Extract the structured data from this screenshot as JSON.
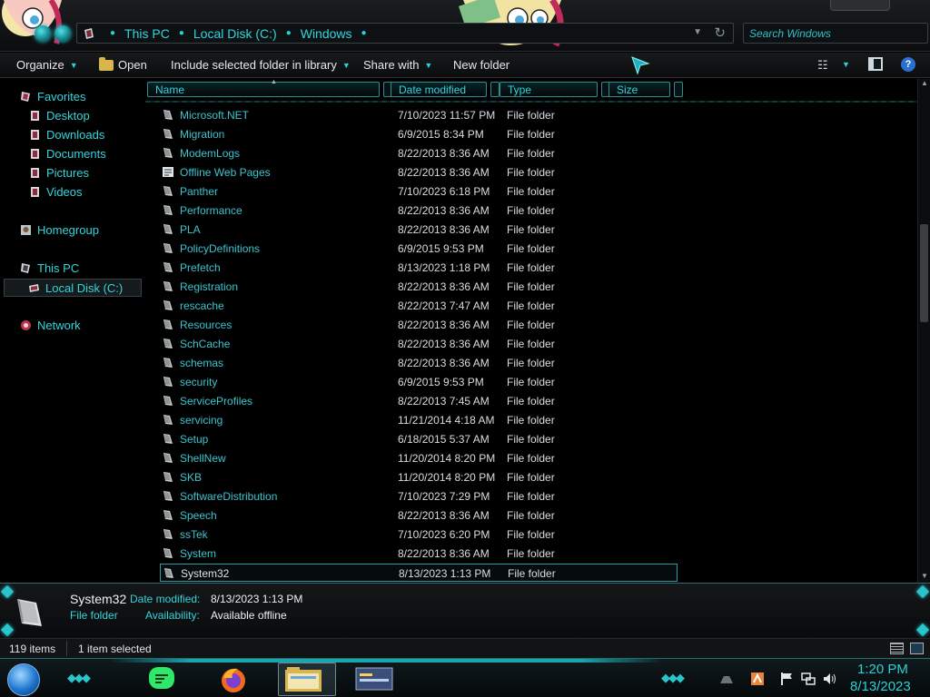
{
  "address": {
    "crumbs": [
      "This PC",
      "Local Disk (C:)",
      "Windows"
    ]
  },
  "search": {
    "placeholder": "Search Windows"
  },
  "toolbar": {
    "organize": "Organize",
    "open": "Open",
    "include": "Include selected folder in library",
    "share": "Share with",
    "new_folder": "New folder"
  },
  "nav": {
    "favorites": "Favorites",
    "desktop": "Desktop",
    "downloads": "Downloads",
    "documents": "Documents",
    "pictures": "Pictures",
    "videos": "Videos",
    "homegroup": "Homegroup",
    "this_pc": "This PC",
    "local_disk": "Local Disk (C:)",
    "network": "Network"
  },
  "columns": {
    "name": "Name",
    "date": "Date modified",
    "type": "Type",
    "size": "Size"
  },
  "files": [
    {
      "name": "Microsoft.NET",
      "date": "7/10/2023 11:57 PM",
      "type": "File folder"
    },
    {
      "name": "Migration",
      "date": "6/9/2015 8:34 PM",
      "type": "File folder"
    },
    {
      "name": "ModemLogs",
      "date": "8/22/2013 8:36 AM",
      "type": "File folder"
    },
    {
      "name": "Offline Web Pages",
      "date": "8/22/2013 8:36 AM",
      "type": "File folder"
    },
    {
      "name": "Panther",
      "date": "7/10/2023 6:18 PM",
      "type": "File folder"
    },
    {
      "name": "Performance",
      "date": "8/22/2013 8:36 AM",
      "type": "File folder"
    },
    {
      "name": "PLA",
      "date": "8/22/2013 8:36 AM",
      "type": "File folder"
    },
    {
      "name": "PolicyDefinitions",
      "date": "6/9/2015 9:53 PM",
      "type": "File folder"
    },
    {
      "name": "Prefetch",
      "date": "8/13/2023 1:18 PM",
      "type": "File folder"
    },
    {
      "name": "Registration",
      "date": "8/22/2013 8:36 AM",
      "type": "File folder"
    },
    {
      "name": "rescache",
      "date": "8/22/2013 7:47 AM",
      "type": "File folder"
    },
    {
      "name": "Resources",
      "date": "8/22/2013 8:36 AM",
      "type": "File folder"
    },
    {
      "name": "SchCache",
      "date": "8/22/2013 8:36 AM",
      "type": "File folder"
    },
    {
      "name": "schemas",
      "date": "8/22/2013 8:36 AM",
      "type": "File folder"
    },
    {
      "name": "security",
      "date": "6/9/2015 9:53 PM",
      "type": "File folder"
    },
    {
      "name": "ServiceProfiles",
      "date": "8/22/2013 7:45 AM",
      "type": "File folder"
    },
    {
      "name": "servicing",
      "date": "11/21/2014 4:18 AM",
      "type": "File folder"
    },
    {
      "name": "Setup",
      "date": "6/18/2015 5:37 AM",
      "type": "File folder"
    },
    {
      "name": "ShellNew",
      "date": "11/20/2014 8:20 PM",
      "type": "File folder"
    },
    {
      "name": "SKB",
      "date": "11/20/2014 8:20 PM",
      "type": "File folder"
    },
    {
      "name": "SoftwareDistribution",
      "date": "7/10/2023 7:29 PM",
      "type": "File folder"
    },
    {
      "name": "Speech",
      "date": "8/22/2013 8:36 AM",
      "type": "File folder"
    },
    {
      "name": "ssTek",
      "date": "7/10/2023 6:20 PM",
      "type": "File folder"
    },
    {
      "name": "System",
      "date": "8/22/2013 8:36 AM",
      "type": "File folder"
    },
    {
      "name": "System32",
      "date": "8/13/2023 1:13 PM",
      "type": "File folder"
    }
  ],
  "selected_index": 24,
  "details": {
    "name": "System32",
    "type": "File folder",
    "modified_label": "Date modified:",
    "modified_value": "8/13/2023 1:13 PM",
    "availability_label": "Availability:",
    "availability_value": "Available offline"
  },
  "status": {
    "count": "119 items",
    "selection": "1 item selected"
  },
  "clock": {
    "time": "1:20 PM",
    "date": "8/13/2023"
  },
  "colors": {
    "accent": "#33d5dc",
    "background": "#000000",
    "text": "#d8dde0"
  },
  "icons": [
    "search-icon",
    "refresh-icon",
    "folder-icon",
    "help-icon",
    "star-icon",
    "network-icon",
    "firefox-icon"
  ]
}
